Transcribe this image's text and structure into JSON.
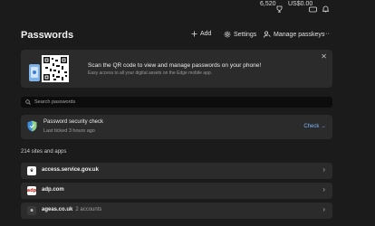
{
  "topbar": {
    "points": "6,520",
    "balance": "US$0.00"
  },
  "header": {
    "title": "Passwords",
    "add_label": "Add",
    "settings_label": "Settings",
    "manage_label": "Manage passkeys",
    "more_label": "···"
  },
  "banner": {
    "title": "Scan the QR code to view and manage passwords on your phone!",
    "subtitle": "Easy access to all your digital assets on the Edge mobile app.",
    "close_label": "✕"
  },
  "search": {
    "placeholder": "Search passwords"
  },
  "security_check": {
    "title": "Password security check",
    "subtitle": "Last ticked 3 hours ago",
    "action_label": "Check →"
  },
  "list": {
    "count_label": "214 sites and apps",
    "chevron": "›",
    "items": [
      {
        "name": "access.service.gov.uk",
        "accounts": "",
        "icon": "gov-uk-crown-icon",
        "favicon_text": "♛",
        "favicon_bg": "#ffffff",
        "favicon_fg": "#0b0c0c"
      },
      {
        "name": "adp.com",
        "accounts": "",
        "icon": "adp-logo-icon",
        "favicon_text": "adp",
        "favicon_bg": "#ffffff",
        "favicon_fg": "#d0271d"
      },
      {
        "name": "ageas.co.uk",
        "accounts": "2 accounts",
        "icon": "globe-icon",
        "favicon_text": "a",
        "favicon_bg": "#3a3a3a",
        "favicon_fg": "#d8d8d8"
      }
    ]
  },
  "colors": {
    "background": "#1b1b1b",
    "card": "#2b2b2b",
    "accent": "#7cb7ff"
  }
}
